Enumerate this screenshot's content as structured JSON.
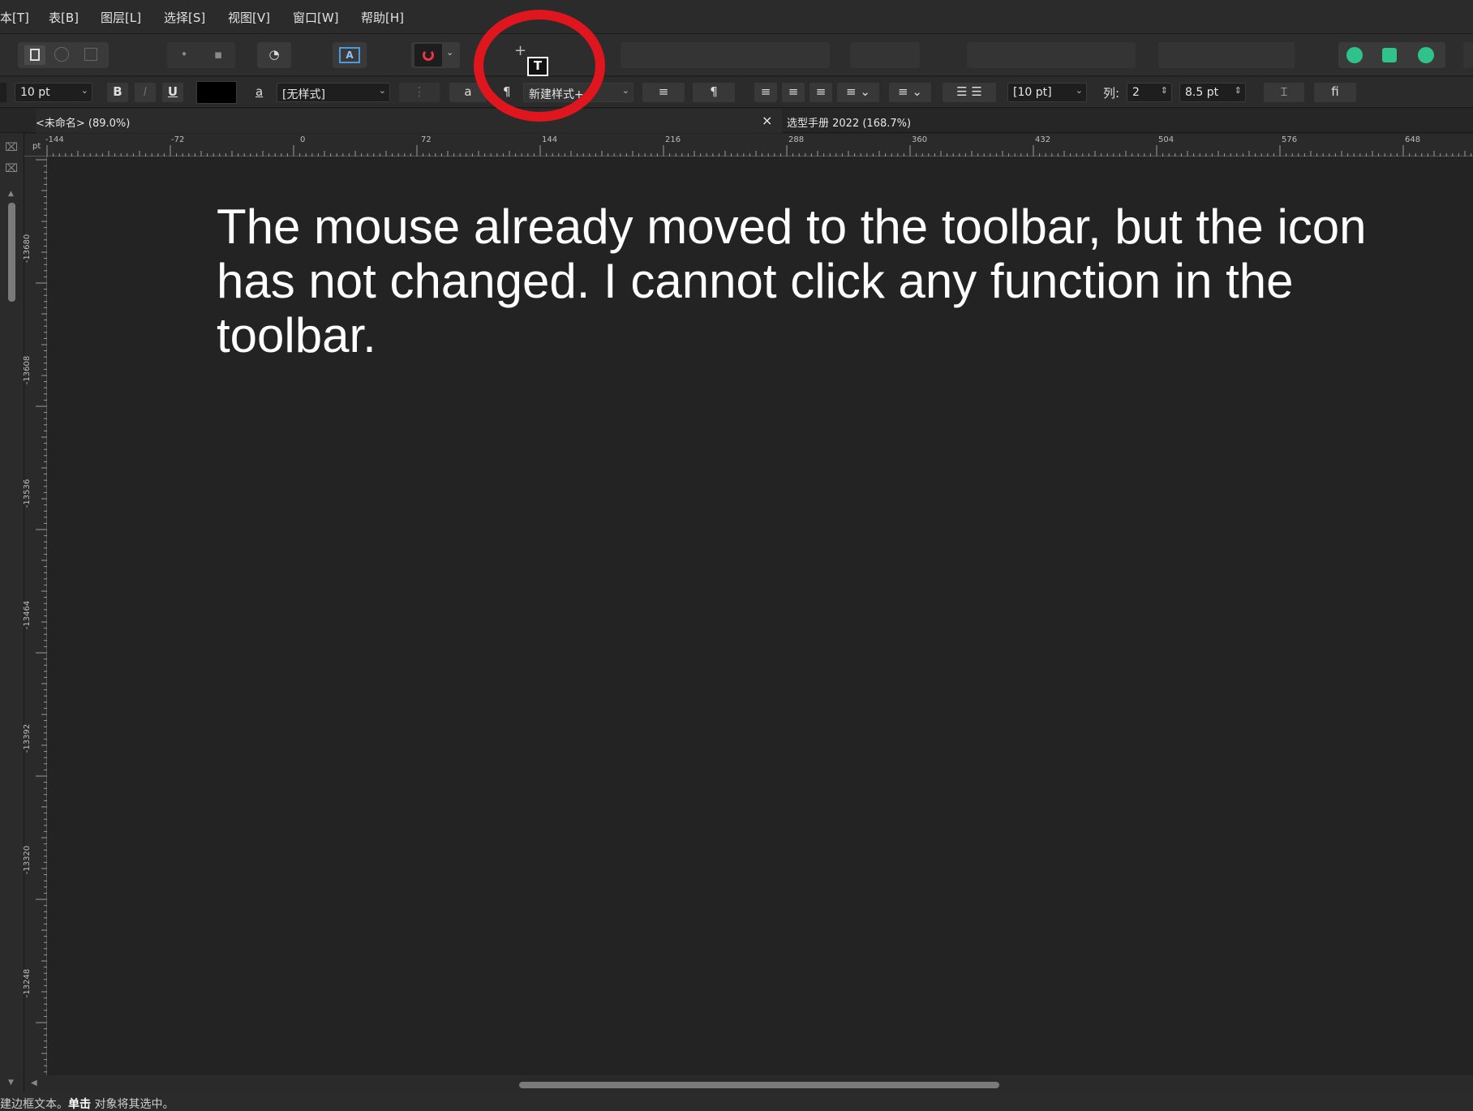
{
  "menu": [
    "本[T]",
    "表[B]",
    "图层[L]",
    "选择[S]",
    "视图[V]",
    "窗口[W]",
    "帮助[H]"
  ],
  "context": {
    "font_size": "10 pt",
    "bold": "B",
    "italic": "I",
    "underline": "U",
    "char_style_glyph": "a",
    "char_style": "[无样式]",
    "para_glyph": "a",
    "pilcrow": "¶",
    "para_style": "新建样式+",
    "leading": "[10 pt]",
    "columns_label": "列:",
    "columns_value": "2",
    "gutter": "8.5 pt",
    "ligature": "fi"
  },
  "tabs": [
    {
      "label": "<未命名> (89.0%)"
    },
    {
      "label": "选型手册 2022 (168.7%)"
    }
  ],
  "tab_close": "×",
  "ruler": {
    "unit": "pt",
    "h_labels": [
      "-144",
      "-72",
      "0",
      "72",
      "144",
      "216",
      "288",
      "360",
      "432",
      "504",
      "576",
      "648"
    ],
    "v_labels": [
      "-13680",
      "-13608",
      "-13536",
      "-13464",
      "-13392",
      "-13320",
      "-13248"
    ]
  },
  "cursor_glyph": "T",
  "crosshair_glyph": "+",
  "annotation": "The mouse already moved to the toolbar, but the icon has not changed. I cannot click any function in the toolbar.",
  "status": {
    "prefix": "建边框文本。",
    "bold": "单击",
    "suffix": " 对象将其选中。"
  },
  "colors": {
    "highlight": "#e0161f",
    "text_color_swatch": "#000000",
    "accent_green": "#2fc28b"
  },
  "icons": {
    "view_mode": "page-view-icon",
    "snapping": "magnet-icon",
    "frame_text": "frame-text-icon"
  }
}
